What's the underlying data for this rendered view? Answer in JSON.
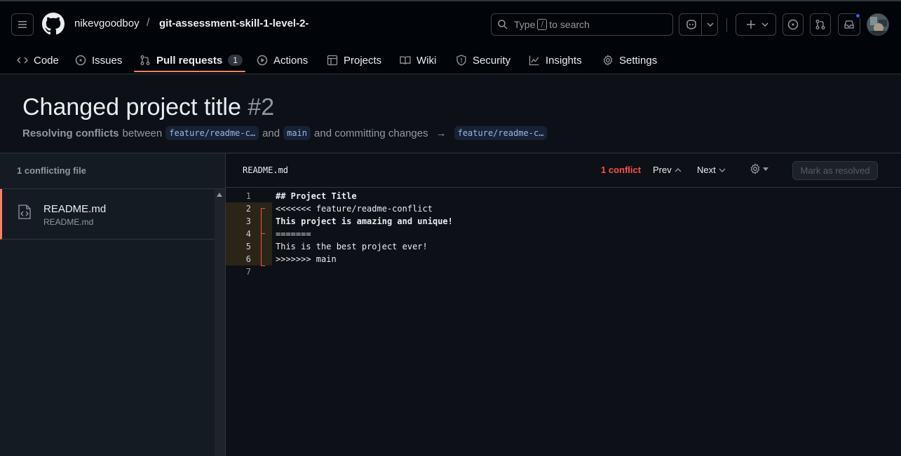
{
  "header": {
    "owner": "nikevgoodboy",
    "separator": "/",
    "repo": "git-assessment-skill-1-level-2-",
    "search": {
      "prefix": "Type",
      "key": "/",
      "suffix": "to search"
    }
  },
  "tabs": [
    {
      "label": "Code",
      "icon": "code-icon"
    },
    {
      "label": "Issues",
      "icon": "issue-icon"
    },
    {
      "label": "Pull requests",
      "icon": "pull-request-icon",
      "counter": "1",
      "active": true
    },
    {
      "label": "Actions",
      "icon": "play-icon"
    },
    {
      "label": "Projects",
      "icon": "table-icon"
    },
    {
      "label": "Wiki",
      "icon": "book-icon"
    },
    {
      "label": "Security",
      "icon": "shield-icon"
    },
    {
      "label": "Insights",
      "icon": "graph-icon"
    },
    {
      "label": "Settings",
      "icon": "gear-icon"
    }
  ],
  "pr": {
    "title": "Changed project title",
    "number": "#2",
    "status_bold": "Resolving conflicts",
    "between": "between",
    "head_branch": "feature/readme-c…",
    "and": "and",
    "base_branch": "main",
    "committing": "and committing changes",
    "arrow": "→",
    "target_branch": "feature/readme-c…"
  },
  "sidebar": {
    "heading": "1 conflicting file",
    "files": [
      {
        "name": "README.md",
        "path": "README.md"
      }
    ]
  },
  "editor": {
    "filename": "README.md",
    "conflict_count": "1 conflict",
    "prev": "Prev",
    "next": "Next",
    "mark_resolved": "Mark as resolved",
    "lines": [
      {
        "n": "1",
        "text": "## Project Title",
        "bold": true,
        "conflict": false
      },
      {
        "n": "2",
        "text": "<<<<<<< feature/readme-conflict",
        "bold": false,
        "conflict": true
      },
      {
        "n": "3",
        "text": "This project is amazing and unique!",
        "bold": true,
        "conflict": true
      },
      {
        "n": "4",
        "text": "=======",
        "bold": false,
        "conflict": true
      },
      {
        "n": "5",
        "text": "This is the best project ever!",
        "bold": false,
        "conflict": true
      },
      {
        "n": "6",
        "text": ">>>>>>> main",
        "bold": false,
        "conflict": true
      },
      {
        "n": "7",
        "text": "",
        "bold": false,
        "conflict": false
      }
    ]
  },
  "colors": {
    "accent": "#f78166",
    "conflict": "#f85149",
    "background": "#0d1117"
  }
}
